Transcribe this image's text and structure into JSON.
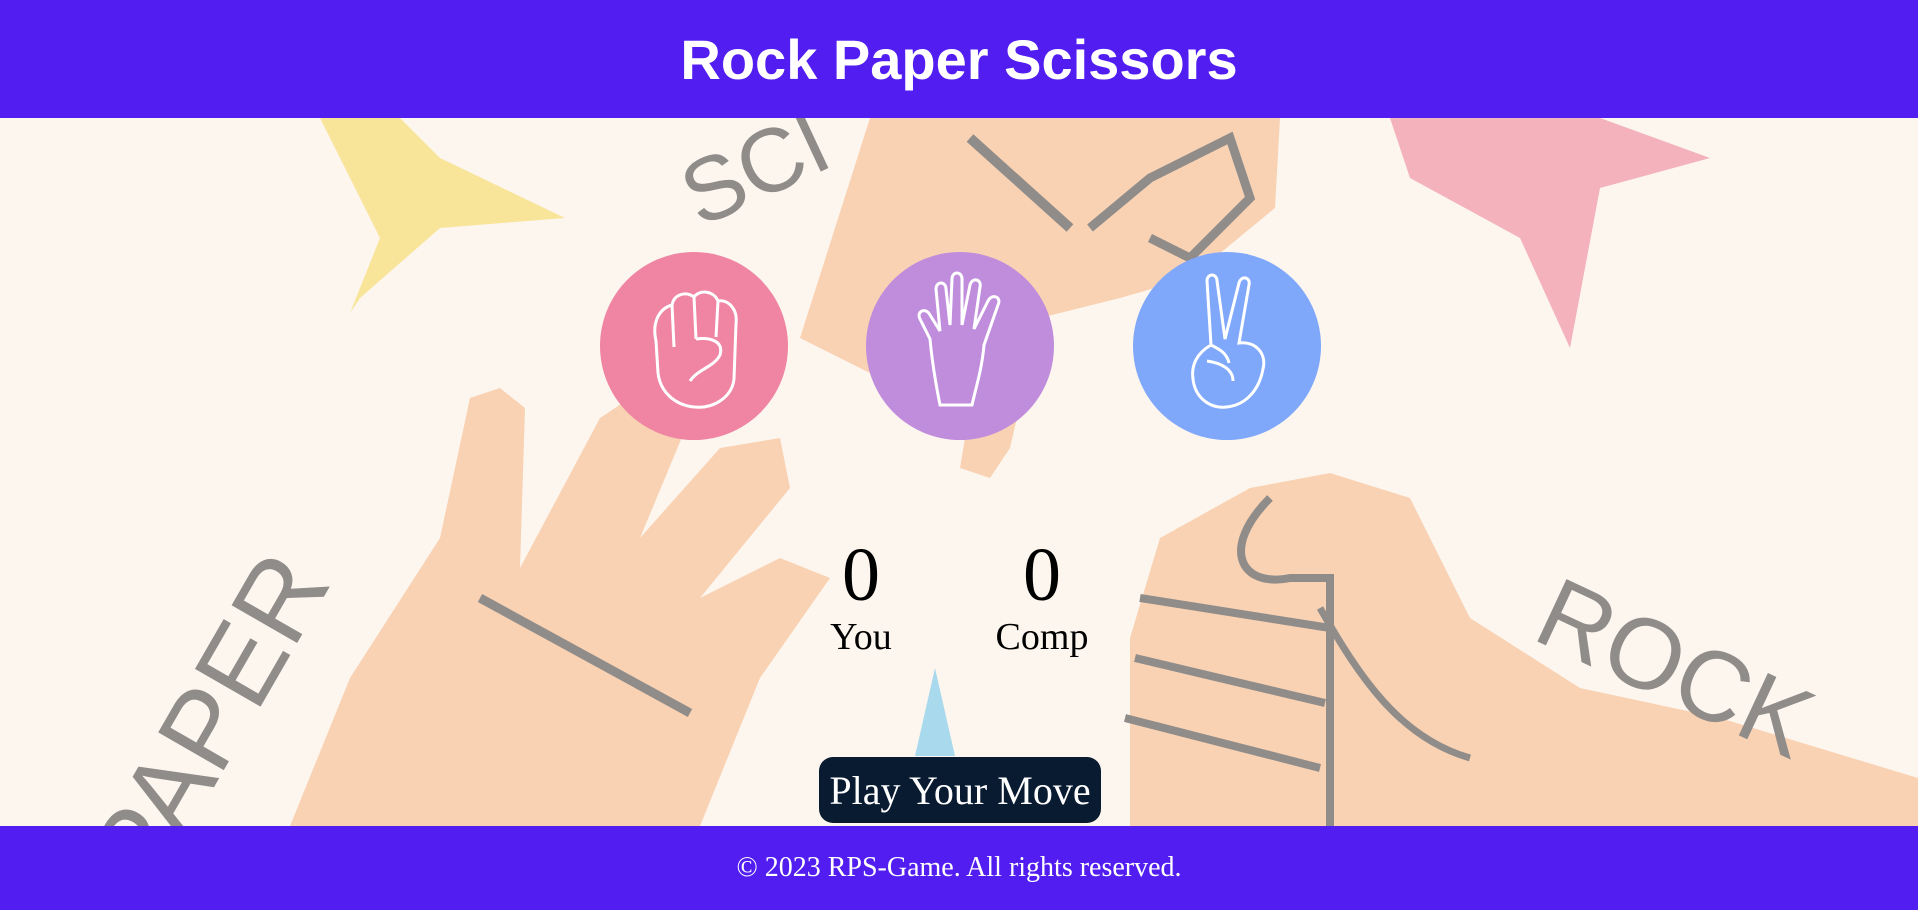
{
  "header": {
    "title": "Rock Paper Scissors"
  },
  "choices": [
    {
      "id": "rock",
      "icon": "rock-fist-icon",
      "color": "#ef85a2"
    },
    {
      "id": "paper",
      "icon": "paper-hand-icon",
      "color": "#c08ddd"
    },
    {
      "id": "scissors",
      "icon": "scissors-hand-icon",
      "color": "#7fa8fb"
    }
  ],
  "scoreboard": {
    "user": {
      "score": "0",
      "label": "You"
    },
    "comp": {
      "score": "0",
      "label": "Comp"
    }
  },
  "message": {
    "label": "Play Your Move"
  },
  "footer": {
    "text": "© 2023 RPS-Game. All rights reserved."
  },
  "background": {
    "words": [
      "SCI",
      "PAPER",
      "ROCK"
    ],
    "colors": {
      "skin": "#f9d2b3",
      "star_yellow": "#f8e59a",
      "star_pink": "#f3b2bc",
      "star_blue": "#a8d9ec"
    }
  },
  "colors": {
    "header_bg": "#521df0",
    "button_bg": "#081b31"
  }
}
